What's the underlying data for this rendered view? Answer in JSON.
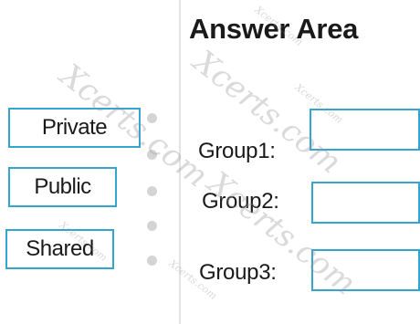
{
  "answer_area": {
    "title": "Answer Area"
  },
  "options": [
    {
      "label": "Private"
    },
    {
      "label": "Public"
    },
    {
      "label": "Shared"
    }
  ],
  "targets": [
    {
      "label": "Group1:",
      "value": ""
    },
    {
      "label": "Group2:",
      "value": ""
    },
    {
      "label": "Group3:",
      "value": ""
    }
  ],
  "watermarks": {
    "large": "Xcerts.com",
    "small": "Xcerts.com"
  }
}
